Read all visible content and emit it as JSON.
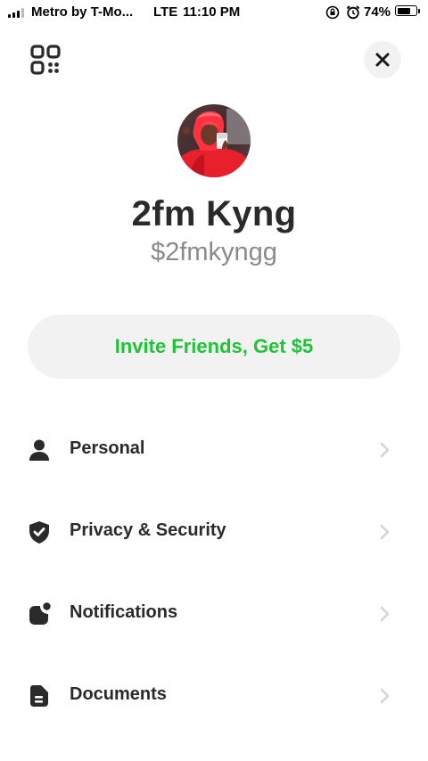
{
  "status_bar": {
    "carrier": "Metro by T-Mo...",
    "network": "LTE",
    "time": "11:10 PM",
    "battery_percent": "74%",
    "battery_level": 0.74
  },
  "top_bar": {
    "qr_icon": "qr-code-icon",
    "close_icon": "close-icon"
  },
  "profile": {
    "display_name": "2fm Kyng",
    "cashtag": "$2fmkyngg"
  },
  "invite": {
    "label": "Invite Friends, Get $5",
    "color": "#1ec337"
  },
  "menu": {
    "items": [
      {
        "label": "Personal",
        "icon": "person-icon"
      },
      {
        "label": "Privacy & Security",
        "icon": "shield-check-icon"
      },
      {
        "label": "Notifications",
        "icon": "notification-icon"
      },
      {
        "label": "Documents",
        "icon": "document-icon"
      }
    ]
  }
}
